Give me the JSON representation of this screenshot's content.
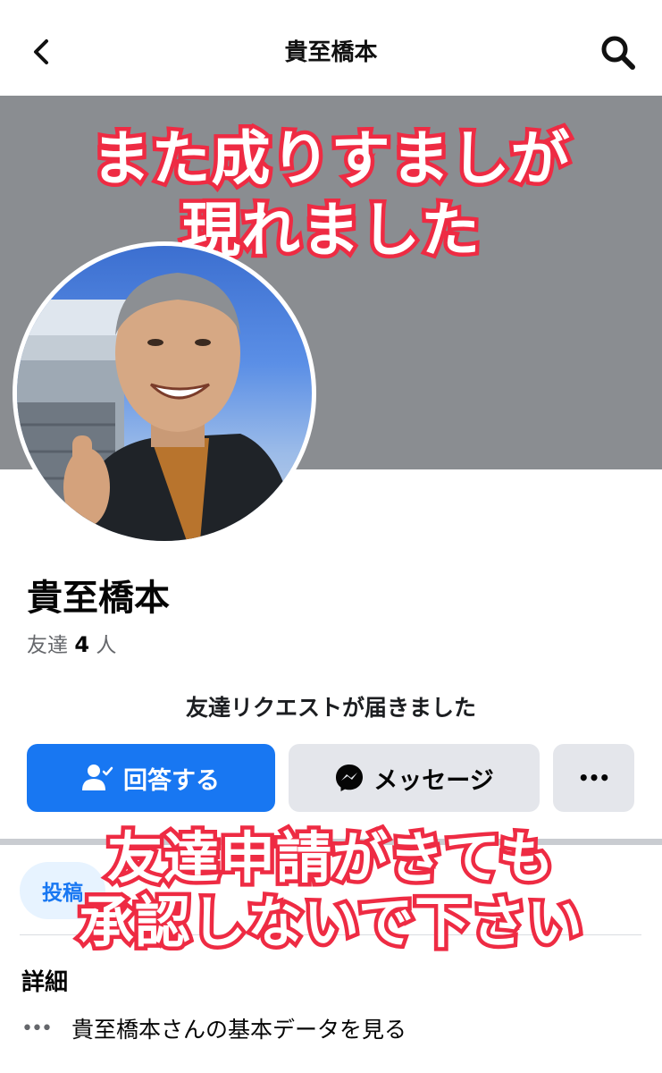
{
  "header": {
    "title": "貴至橋本"
  },
  "overlay": {
    "top_line1": "また成りすましが",
    "top_line2": "現れました",
    "bottom_line1": "友達申請がきても",
    "bottom_line2": "承認しないで下さい"
  },
  "profile": {
    "name": "貴至橋本",
    "friends_label": "友達",
    "friends_count": "4",
    "friends_unit": "人",
    "request_message": "友達リクエストが届きました"
  },
  "actions": {
    "answer_label": "回答する",
    "message_label": "メッセージ",
    "more_label": "•••"
  },
  "tabs": {
    "posts_label": "投稿"
  },
  "details": {
    "heading": "詳細",
    "basic_data_link": "貴至橋本さんの基本データを見る",
    "dots": "•••"
  },
  "colors": {
    "accent": "#1877f2",
    "cover": "#8a8d91",
    "overlay_outline": "#ee2b43"
  }
}
